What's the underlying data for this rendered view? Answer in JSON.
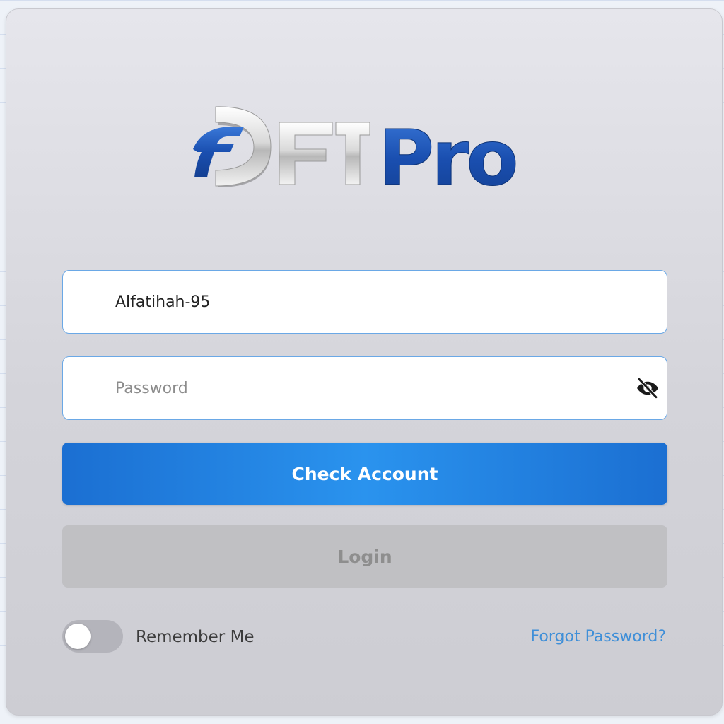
{
  "brand": {
    "logo_left": "FDFT",
    "logo_right": "Pro",
    "colors": {
      "blue": "#1f55b8",
      "silver": "#dcdcdc"
    }
  },
  "form": {
    "username_value": "Alfatihah-95",
    "password_value": "",
    "password_placeholder": "Password",
    "eye_icon": "eye-off-icon",
    "check_account_label": "Check Account",
    "login_label": "Login",
    "login_disabled": true,
    "remember_me_label": "Remember Me",
    "remember_me_on": false,
    "forgot_password_label": "Forgot Password?"
  },
  "colors": {
    "accent": "#2a93ee",
    "link": "#3f8fd8",
    "disabled_bg": "#c0c0c3",
    "disabled_text": "#8e8e8e",
    "field_border": "#6aa8e6"
  }
}
